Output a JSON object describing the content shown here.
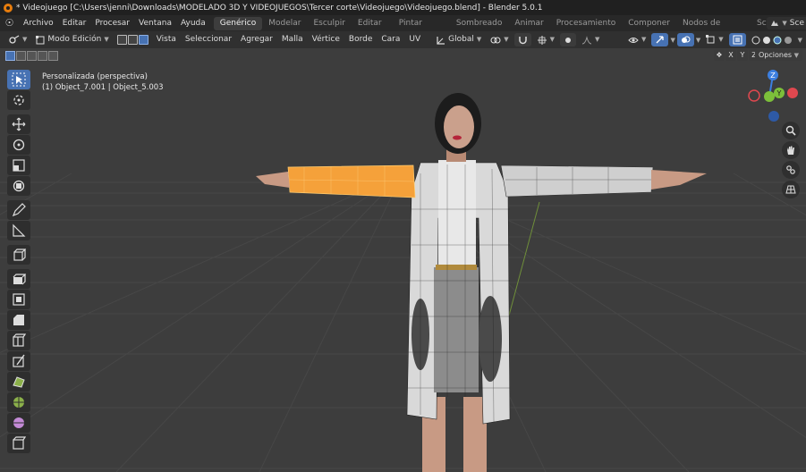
{
  "window": {
    "title": "* Videojuego [C:\\Users\\jenni\\Downloads\\MODELADO 3D Y VIDEOJUEGOS\\Tercer corte\\Videojuego\\Videojuego.blend] - Blender 5.0.1"
  },
  "menubar": {
    "items": [
      "Archivo",
      "Editar",
      "Procesar",
      "Ventana",
      "Ayuda"
    ],
    "workspaces": [
      "Genérico",
      "Modelar",
      "Esculpir",
      "Editar UV",
      "Pintar texturas",
      "Sombreado",
      "Animar",
      "Procesamiento",
      "Componer",
      "Nodos de geometría",
      "Scripts"
    ],
    "active_workspace": "Genérico",
    "scene_label": "Sce"
  },
  "header": {
    "mode": "Modo Edición",
    "menus": [
      "Vista",
      "Seleccionar",
      "Agregar",
      "Malla",
      "Vértice",
      "Borde",
      "Cara",
      "UV"
    ],
    "transform_orientation": "Global"
  },
  "subheader": {
    "axes": [
      "X",
      "Y",
      "Z"
    ],
    "options_label": "Opciones"
  },
  "viewport": {
    "view_name": "Personalizada (perspectiva)",
    "object_info": "(1) Object_7.001 | Object_5.003"
  },
  "gizmo": {
    "z_label": "Z",
    "y_label": "Y",
    "colors": {
      "x": "#e0484f",
      "y": "#7cbf3a",
      "z": "#3c7fe0",
      "x_neg": "#8a3338",
      "y_neg": "#4d7a28",
      "z_neg": "#2e5aa6"
    }
  },
  "colors": {
    "accent": "#4772b3",
    "selection": "#f5a13a",
    "viewport_bg": "#3d3d3d"
  }
}
